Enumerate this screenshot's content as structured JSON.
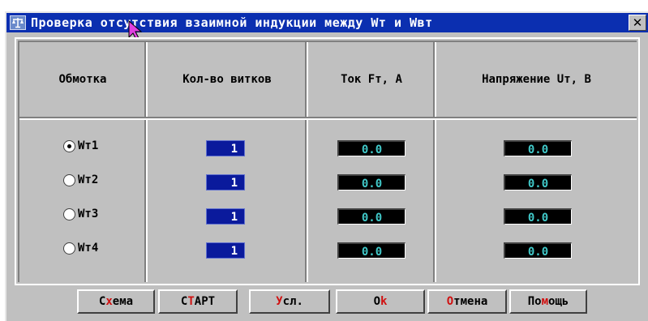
{
  "window": {
    "title": "Проверка отсутствия взаимной индукции между Wт и Wвт",
    "icon": "balance-scale-icon",
    "close_icon": "close-icon",
    "close_label": "✕"
  },
  "table": {
    "headers": [
      "Обмотка",
      "Кол-во витков",
      "Ток Fт, А",
      "Напряжение Uт, В"
    ],
    "rows": [
      {
        "winding": "Wт1",
        "selected": true,
        "turns": "1",
        "current": "0.0",
        "voltage": "0.0"
      },
      {
        "winding": "Wт2",
        "selected": false,
        "turns": "1",
        "current": "0.0",
        "voltage": "0.0"
      },
      {
        "winding": "Wт3",
        "selected": false,
        "turns": "1",
        "current": "0.0",
        "voltage": "0.0"
      },
      {
        "winding": "Wт4",
        "selected": false,
        "turns": "1",
        "current": "0.0",
        "voltage": "0.0"
      }
    ]
  },
  "buttons": [
    {
      "label": "Схема",
      "hotkey_index": 1
    },
    {
      "label": "СТАРТ",
      "hotkey_index": 1
    },
    {
      "label": "Усл.",
      "hotkey_index": 0
    },
    {
      "label": "Ok",
      "hotkey_index": 1
    },
    {
      "label": "Отмена",
      "hotkey_index": 0
    },
    {
      "label": "Помощь",
      "hotkey_index": 2
    }
  ],
  "colors": {
    "title_bar": "#0b2fb0",
    "dialog_bg": "#c0c0c0",
    "turns_field_bg": "#0a1a9c",
    "readout_bg": "#000000",
    "readout_text": "#40c8c8",
    "hotkey": "#d01010"
  }
}
